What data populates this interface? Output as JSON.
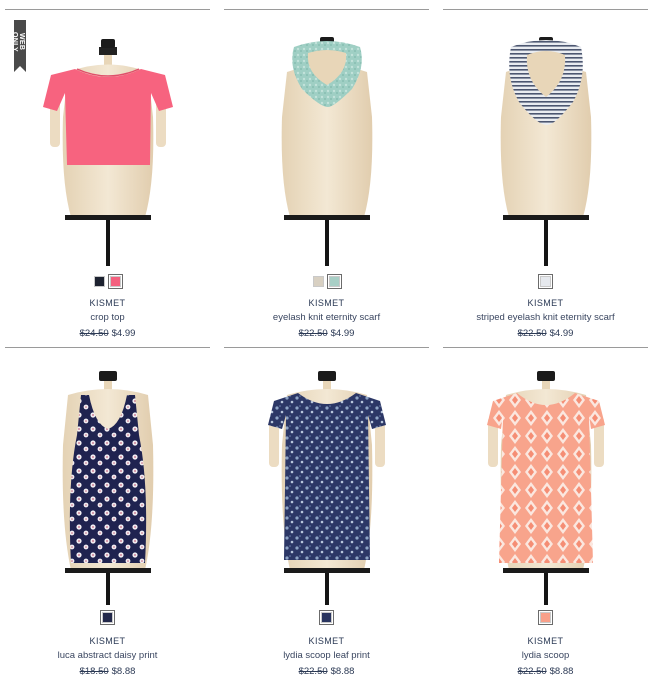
{
  "badge": {
    "label": "WEB ONLY"
  },
  "products": [
    {
      "brand": "KISMET",
      "name": "crop top",
      "old_price": "$24.50",
      "price": "$4.99",
      "swatches": [
        {
          "color": "#1d2230",
          "selected": false
        },
        {
          "color": "#f4607e",
          "selected": true
        }
      ]
    },
    {
      "brand": "KISMET",
      "name": "eyelash knit eternity scarf",
      "old_price": "$22.50",
      "price": "$4.99",
      "swatches": [
        {
          "color": "#d8d0c2",
          "selected": false
        },
        {
          "color": "#a8cfc6",
          "selected": true
        }
      ]
    },
    {
      "brand": "KISMET",
      "name": "striped eyelash knit eternity scarf",
      "old_price": "$22.50",
      "price": "$4.99",
      "swatches": [
        {
          "color": "#e6e9ee",
          "selected": true
        }
      ]
    },
    {
      "brand": "KISMET",
      "name": "luca abstract daisy print",
      "old_price": "$18.50",
      "price": "$8.88",
      "swatches": [
        {
          "color": "#23284a",
          "selected": true
        }
      ]
    },
    {
      "brand": "KISMET",
      "name": "lydia scoop leaf print",
      "old_price": "$22.50",
      "price": "$8.88",
      "swatches": [
        {
          "color": "#2a3560",
          "selected": true
        }
      ]
    },
    {
      "brand": "KISMET",
      "name": "lydia scoop",
      "old_price": "$22.50",
      "price": "$8.88",
      "swatches": [
        {
          "color": "#f8a08a",
          "selected": true
        }
      ]
    }
  ]
}
